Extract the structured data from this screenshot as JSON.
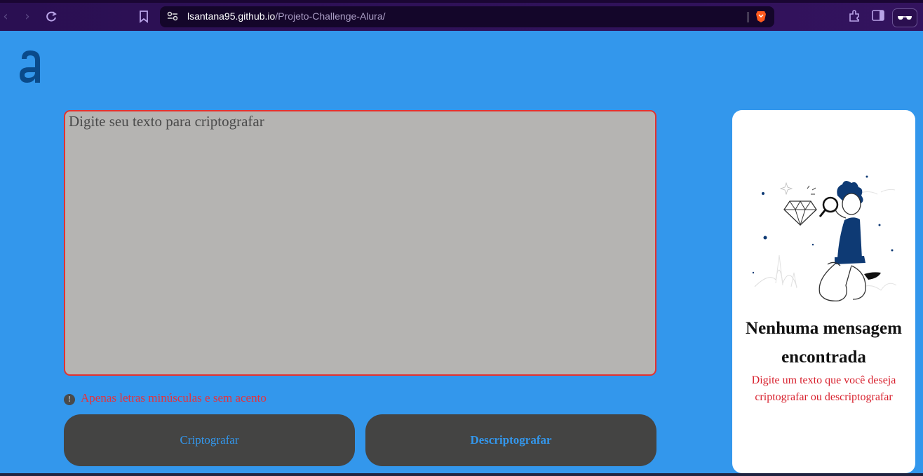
{
  "browser": {
    "url_host": "lsantana95.github.io",
    "url_path": "/Projeto-Challenge-Alura/"
  },
  "input": {
    "placeholder": "Digite seu texto para criptografar"
  },
  "hint": {
    "text": "Apenas letras minúsculas e sem acento"
  },
  "buttons": {
    "encrypt_label": "Criptografar",
    "decrypt_label": "Descriptografar"
  },
  "output": {
    "title": "Nenhuma mensagem encontrada",
    "description": "Digite um texto que você deseja criptografar ou descriptografar"
  },
  "colors": {
    "page_bg": "#3397ec",
    "input_border": "#e4322f",
    "button_bg": "#444443",
    "accent_red": "#d8202d"
  }
}
